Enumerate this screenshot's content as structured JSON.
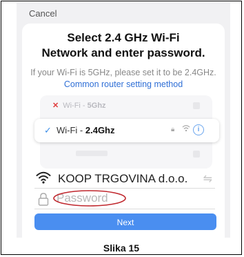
{
  "header": {
    "cancel_label": "Cancel"
  },
  "title": {
    "line1": "Select 2.4 GHz Wi-Fi",
    "line2": "Network and enter password."
  },
  "hint": {
    "text": "If your Wi-Fi is 5GHz, please set it to be 2.4GHz. ",
    "link": "Common router setting method"
  },
  "example": {
    "bad": {
      "prefix": "Wi-Fi - ",
      "band": "5Ghz"
    },
    "good": {
      "prefix": "Wi-Fi - ",
      "band": "2.4Ghz"
    }
  },
  "network": {
    "ssid": "KOOP TRGOVINA d.o.o."
  },
  "password": {
    "placeholder": "Password"
  },
  "actions": {
    "next_label": "Next"
  },
  "caption": "Slika 15",
  "colors": {
    "accent": "#4a8ef0",
    "link": "#2f6fd6",
    "error": "#e03c3c",
    "annotation": "#c0272d"
  }
}
